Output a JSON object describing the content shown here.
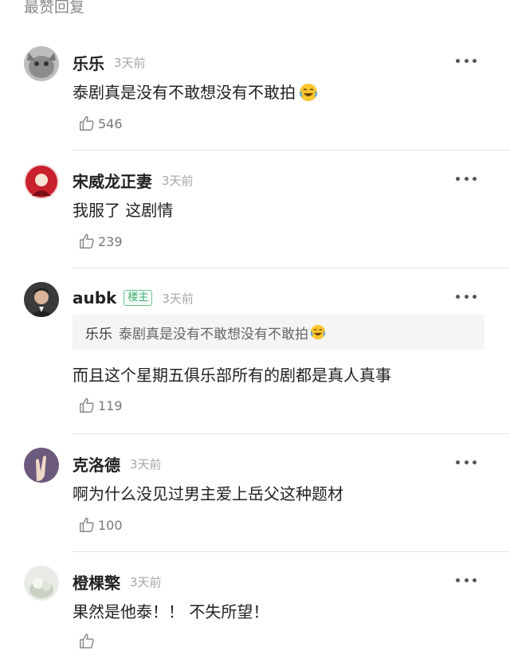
{
  "section_title": "最赞回复",
  "comments": [
    {
      "name": "乐乐",
      "time": "3天前",
      "text": "泰剧真是没有不敢想没有不敢拍",
      "emoji": "laughing-crying-emoji",
      "likes": "546"
    },
    {
      "name": "宋威龙正妻",
      "time": "3天前",
      "text": "我服了 这剧情",
      "likes": "239"
    },
    {
      "name": "aubk",
      "badge": "楼主",
      "time": "3天前",
      "quote": {
        "name": "乐乐",
        "text": "泰剧真是没有不敢想没有不敢拍",
        "emoji": "laughing-crying-emoji"
      },
      "text": "而且这个星期五俱乐部所有的剧都是真人真事",
      "likes": "119"
    },
    {
      "name": "克洛德",
      "time": "3天前",
      "text": "啊为什么没见过男主爱上岳父这种题材",
      "likes": "100"
    },
    {
      "name": "橙棵檠",
      "time": "3天前",
      "text": "果然是他泰！！ 不失所望！"
    }
  ],
  "icons": {
    "like": "thumbs-up-icon",
    "more": "more-dots-icon"
  },
  "colors": {
    "badge_green": "#3fae6b",
    "secondary_text": "#a6a6a6"
  }
}
